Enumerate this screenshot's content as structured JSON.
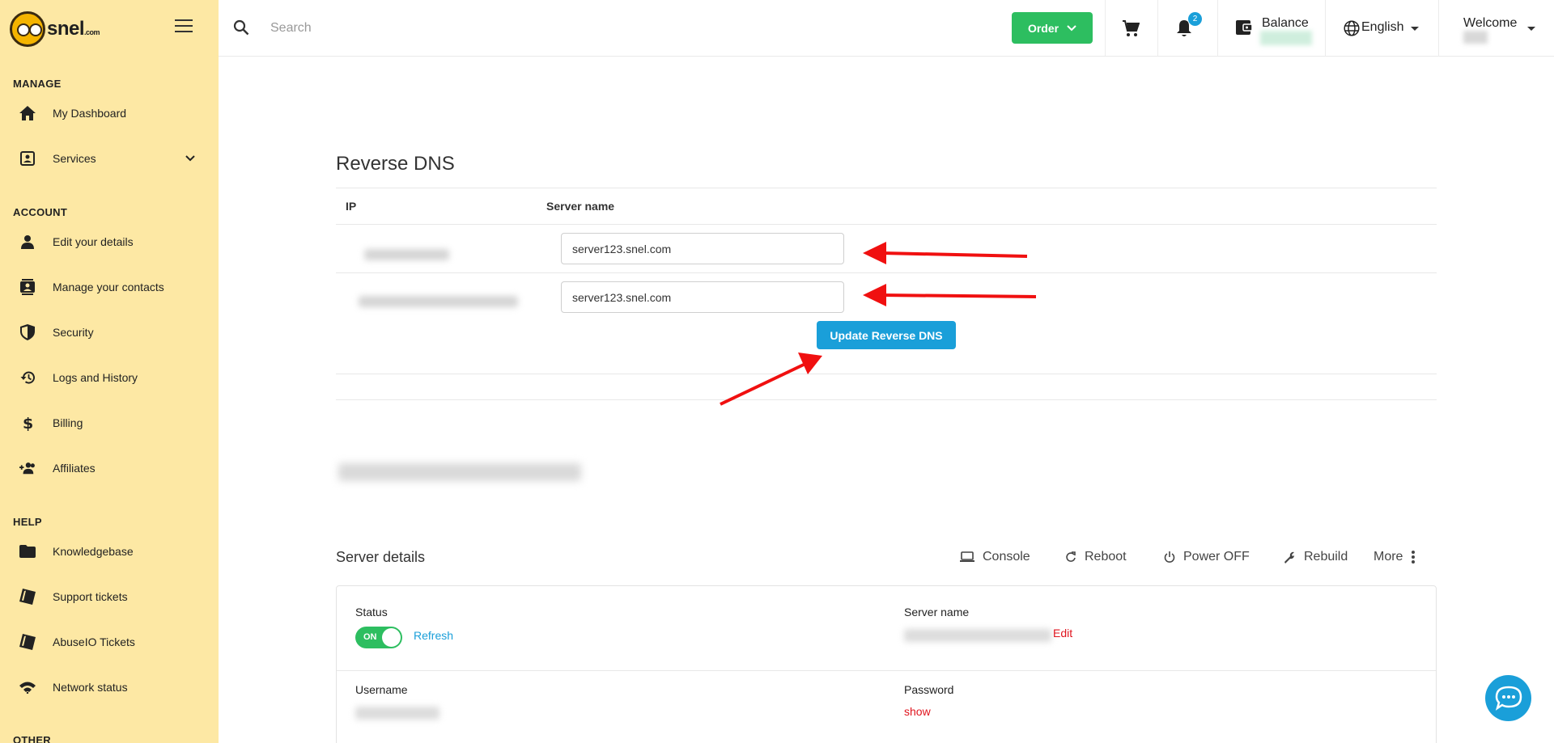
{
  "sidebar": {
    "logo_text": "snel",
    "logo_suffix": ".com",
    "sections": {
      "manage": "MANAGE",
      "account": "ACCOUNT",
      "help": "HELP",
      "other": "OTHER"
    },
    "items": {
      "dashboard": "My Dashboard",
      "services": "Services",
      "edit_details": "Edit your details",
      "contacts": "Manage your contacts",
      "security": "Security",
      "logs": "Logs and History",
      "billing": "Billing",
      "affiliates": "Affiliates",
      "knowledgebase": "Knowledgebase",
      "support": "Support tickets",
      "abuseio": "AbuseIO Tickets",
      "network": "Network status"
    }
  },
  "topbar": {
    "search_placeholder": "Search",
    "order_label": "Order",
    "notification_count": "2",
    "balance_label": "Balance",
    "language": "English",
    "welcome": "Welcome"
  },
  "reverse_dns": {
    "title": "Reverse DNS",
    "col_ip": "IP",
    "col_server_name": "Server name",
    "rows": [
      {
        "server_name": "server123.snel.com"
      },
      {
        "server_name": "server123.snel.com"
      }
    ],
    "update_button": "Update Reverse DNS"
  },
  "server_details": {
    "title": "Server details",
    "actions": {
      "console": "Console",
      "reboot": "Reboot",
      "power_off": "Power OFF",
      "rebuild": "Rebuild",
      "more": "More"
    },
    "status_label": "Status",
    "toggle_text": "ON",
    "refresh": "Refresh",
    "server_name_label": "Server name",
    "edit": "Edit",
    "username_label": "Username",
    "password_label": "Password",
    "show": "show"
  },
  "colors": {
    "sidebar_bg": "#fde8a4",
    "accent_green": "#2dbe60",
    "accent_blue": "#1a9fd9",
    "link_red": "#e0141e",
    "annotation_arrow": "#f01010"
  }
}
